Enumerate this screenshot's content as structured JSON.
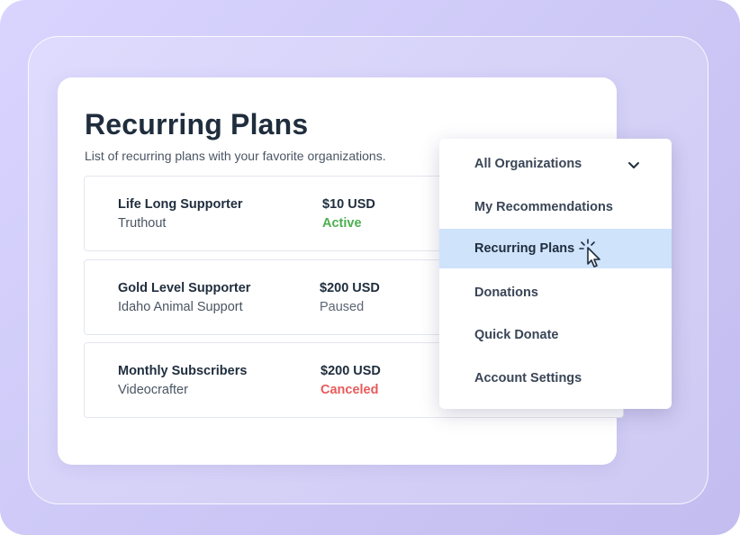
{
  "card": {
    "title": "Recurring Plans",
    "subtitle": "List of recurring plans with your favorite organizations."
  },
  "plans": [
    {
      "name": "Life Long Supporter",
      "organization": "Truthout",
      "amount": "$10 USD",
      "status": "Active",
      "status_color": "#4caf50"
    },
    {
      "name": "Gold Level Supporter",
      "organization": "Idaho Animal Support",
      "amount": "$200 USD",
      "status": "Paused",
      "status_color": "#5b6573"
    },
    {
      "name": "Monthly Subscribers",
      "organization": "Videocrafter",
      "amount": "$200 USD",
      "status": "Canceled",
      "status_color": "#e85a5a"
    }
  ],
  "menu": {
    "items": [
      {
        "label": "All Organizations",
        "icon": "chevron-down-icon"
      },
      {
        "label": "My Recommendations"
      },
      {
        "label": "Recurring Plans",
        "active": true
      },
      {
        "label": "Donations"
      },
      {
        "label": "Quick Donate"
      },
      {
        "label": "Account Settings"
      }
    ]
  },
  "colors": {
    "background": "#d3cefa",
    "active_item": "#cfe3fb",
    "heading": "#1f2d3d"
  }
}
